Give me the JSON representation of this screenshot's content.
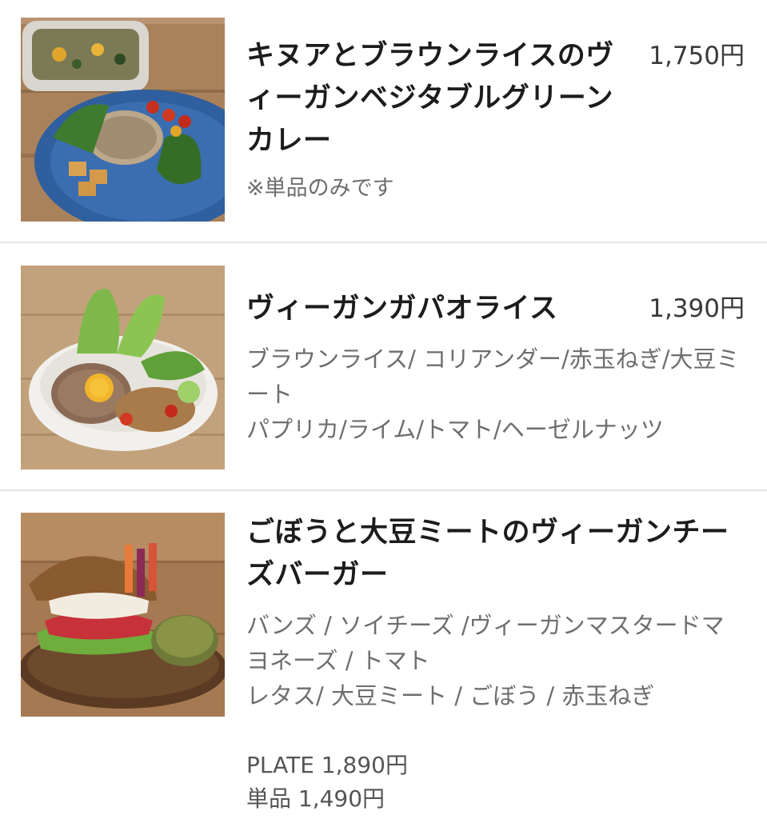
{
  "items": [
    {
      "title": "キヌアとブラウンライスのヴィーガンベジタブルグリーンカレー",
      "price": "1,750円",
      "note": "※単品のみです"
    },
    {
      "title": "ヴィーガンガパオライス",
      "price": "1,390円",
      "desc": "ブラウンライス/ コリアンダー/赤玉ねぎ/大豆ミート\nパプリカ/ライム/トマト/ヘーゼルナッツ"
    },
    {
      "title": "ごぼうと大豆ミートのヴィーガンチーズバーガー",
      "desc": "バンズ / ソイチーズ /ヴィーガンマスタードマヨネーズ / トマト\nレタス/ 大豆ミート / ごぼう / 赤玉ねぎ",
      "plate_price": "PLATE 1,890円",
      "single_price": "単品 1,490円"
    }
  ]
}
